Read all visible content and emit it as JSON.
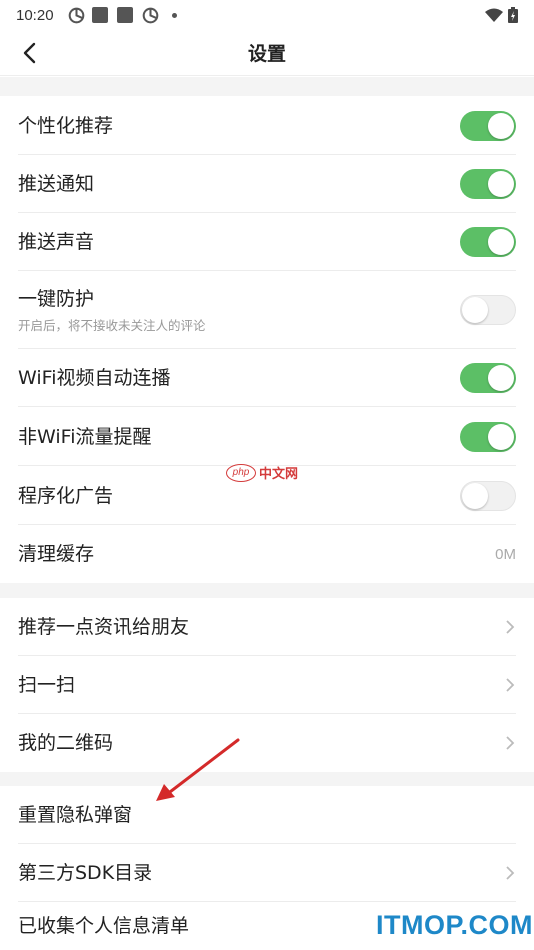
{
  "status_bar": {
    "time": "10:20"
  },
  "header": {
    "title": "设置"
  },
  "group1": [
    {
      "label": "个性化推荐",
      "toggle": "on"
    },
    {
      "label": "推送通知",
      "toggle": "on"
    },
    {
      "label": "推送声音",
      "toggle": "on"
    },
    {
      "label": "一键防护",
      "sub": "开启后，将不接收未关注人的评论",
      "toggle": "off"
    },
    {
      "label": "WiFi视频自动连播",
      "toggle": "on"
    },
    {
      "label": "非WiFi流量提醒",
      "toggle": "on"
    },
    {
      "label": "程序化广告",
      "toggle": "off"
    },
    {
      "label": "清理缓存",
      "value": "0M"
    }
  ],
  "group2": [
    {
      "label": "推荐一点资讯给朋友"
    },
    {
      "label": "扫一扫"
    },
    {
      "label": "我的二维码"
    }
  ],
  "group3": [
    {
      "label": "重置隐私弹窗"
    },
    {
      "label": "第三方SDK目录"
    },
    {
      "label": "已收集个人信息清单"
    }
  ],
  "watermarks": {
    "php_badge": "php",
    "php_text": "中文网",
    "itmop": "ITMOP.COM"
  },
  "colors": {
    "toggle_on": "#5cbf66",
    "toggle_off": "#f1f1f1",
    "arrow": "#d42a2a",
    "itmop": "#1e88c8"
  }
}
